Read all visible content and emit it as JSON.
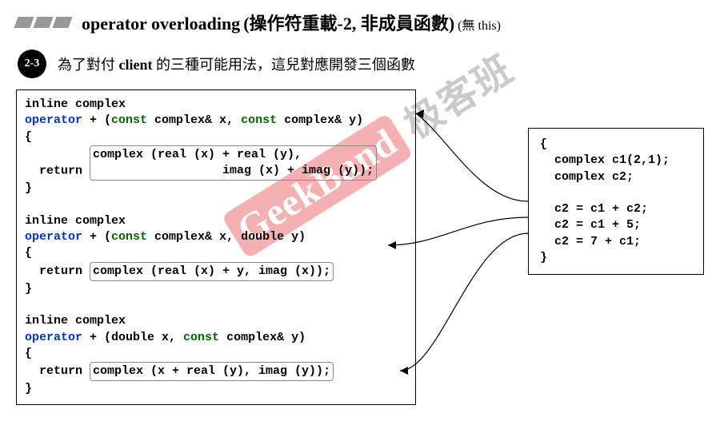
{
  "header": {
    "title_en": "operator overloading",
    "title_zh": "(操作符重載-2, 非成員函數)",
    "title_note": "(無 this)"
  },
  "badge": "2-3",
  "intro": {
    "p1": "為了對付 ",
    "bold": "client",
    "p2": " 的三種可能用法，這兒對應開發三個函數"
  },
  "code_left": {
    "l01": "inline complex",
    "l02a": "operator",
    "l02b": " + (",
    "l02c": "const",
    "l02d": " complex& x, ",
    "l02e": "const",
    "l02f": " complex& y)",
    "l03": "{",
    "l04a": "  return ",
    "l04b": "complex (real (x) + real (y),",
    "l05": "                  imag (x) + imag (y));",
    "l06": "}",
    "gap1": "",
    "l07": "inline complex",
    "l08a": "operator",
    "l08b": " + (",
    "l08c": "const",
    "l08d": " complex& x, double y)",
    "l09": "{",
    "l10a": "  return ",
    "l10b": "complex (real (x) + y, imag (x));",
    "l11": "}",
    "gap2": "",
    "l12": "inline complex",
    "l13a": "operator",
    "l13b": " + (double x, ",
    "l13c": "const",
    "l13d": " complex& y)",
    "l14": "{",
    "l15a": "  return ",
    "l15b": "complex (x + real (y), imag (y));",
    "l16": "}"
  },
  "code_right": {
    "r1": "{",
    "r2": "  complex c1(2,1);",
    "r3": "  complex c2;",
    "r4": "",
    "r5": "  c2 = c1 + c2;",
    "r6": "  c2 = c1 + 5;",
    "r7": "  c2 = 7 + c1;",
    "r8": "}"
  },
  "watermark": {
    "en": "GeekBand",
    "zh": "极客班"
  }
}
